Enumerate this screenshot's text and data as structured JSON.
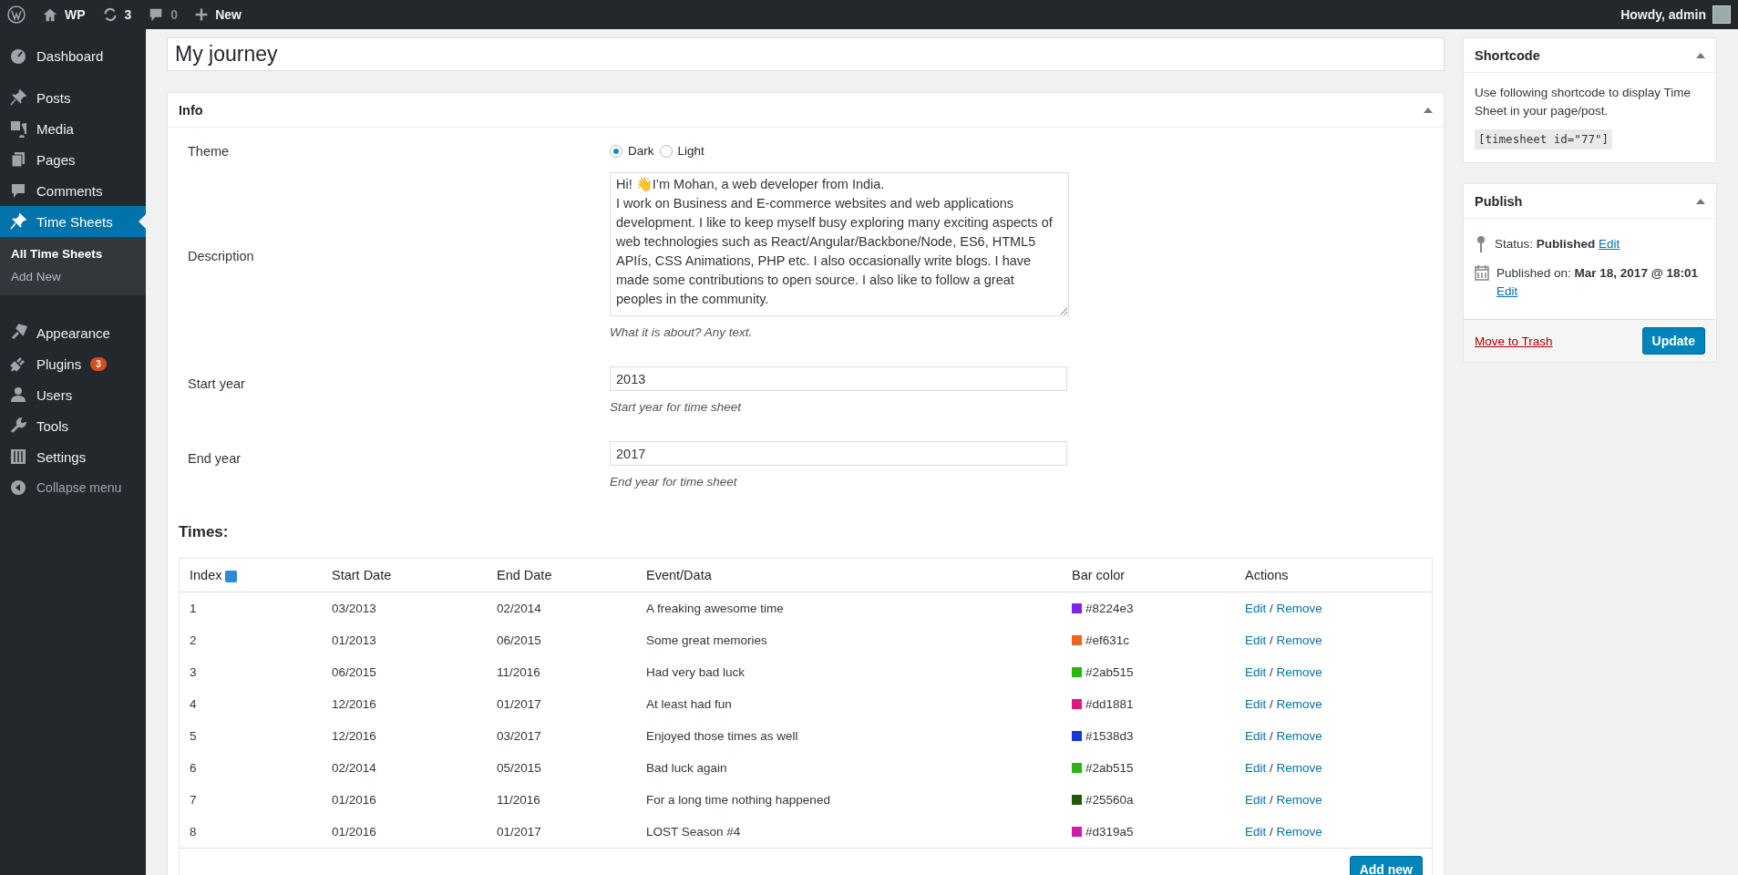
{
  "admin_bar": {
    "site": "WP",
    "updates": "3",
    "comments": "0",
    "new": "New",
    "greeting": "Howdy, admin"
  },
  "sidebar": {
    "items": [
      {
        "label": "Dashboard",
        "selected": false
      },
      {
        "label": "Posts",
        "selected": false
      },
      {
        "label": "Media",
        "selected": false
      },
      {
        "label": "Pages",
        "selected": false
      },
      {
        "label": "Comments",
        "selected": false
      },
      {
        "label": "Time Sheets",
        "selected": true,
        "children": [
          {
            "label": "All Time Sheets",
            "selected": true
          },
          {
            "label": "Add New",
            "selected": false
          }
        ]
      },
      {
        "label": "Appearance",
        "selected": false
      },
      {
        "label": "Plugins",
        "selected": false,
        "badge": "3"
      },
      {
        "label": "Users",
        "selected": false
      },
      {
        "label": "Tools",
        "selected": false
      },
      {
        "label": "Settings",
        "selected": false
      }
    ],
    "collapse": "Collapse menu"
  },
  "title": "My journey",
  "info": {
    "heading": "Info",
    "fields": [
      {
        "kind": "radio",
        "label": "Theme",
        "options": [
          {
            "label": "Dark",
            "selected": true
          },
          {
            "label": "Light",
            "selected": false
          }
        ]
      },
      {
        "kind": "textarea",
        "label": "Description",
        "value": "Hi! 👋I’m Mohan, a web developer from India.\nI work on Business and E-commerce websites and web applications development. I like to keep myself busy exploring many exciting aspects of web technologies such as React/Angular/Backbone/Node, ES6, HTML5 APIís, CSS Animations, PHP etc. I also occasionally write blogs. I have made some contributions to open source. I also like to follow a great peoples in the community.",
        "hint": "What it is about? Any text."
      },
      {
        "kind": "text",
        "label": "Start year",
        "value": "2013",
        "hint": "Start year for time sheet"
      },
      {
        "kind": "text",
        "label": "End year",
        "value": "2017",
        "hint": "End year for time sheet"
      }
    ]
  },
  "times": {
    "heading": "Times:",
    "columns": [
      "Index",
      "Start Date",
      "End Date",
      "Event/Data",
      "Bar color",
      "Actions"
    ],
    "rows": [
      {
        "index": "1",
        "start": "03/2013",
        "end": "02/2014",
        "event": "A freaking awesome time",
        "color": "#8224e3",
        "color_text": "#8224e3",
        "edit": "Edit",
        "separator": "/",
        "remove": "Remove"
      },
      {
        "index": "2",
        "start": "01/2013",
        "end": "06/2015",
        "event": "Some great memories",
        "color": "#ef631c",
        "color_text": "#ef631c",
        "edit": "Edit",
        "separator": "/",
        "remove": "Remove"
      },
      {
        "index": "3",
        "start": "06/2015",
        "end": "11/2016",
        "event": "Had very bad luck",
        "color": "#2ab515",
        "color_text": "#2ab515",
        "edit": "Edit",
        "separator": "/",
        "remove": "Remove"
      },
      {
        "index": "4",
        "start": "12/2016",
        "end": "01/2017",
        "event": "At least had fun",
        "color": "#dd1881",
        "color_text": "#dd1881",
        "edit": "Edit",
        "separator": "/",
        "remove": "Remove"
      },
      {
        "index": "5",
        "start": "12/2016",
        "end": "03/2017",
        "event": "Enjoyed those times as well",
        "color": "#1538d3",
        "color_text": "#1538d3",
        "edit": "Edit",
        "separator": "/",
        "remove": "Remove"
      },
      {
        "index": "6",
        "start": "02/2014",
        "end": "05/2015",
        "event": "Bad luck again",
        "color": "#2ab515",
        "color_text": "#2ab515",
        "edit": "Edit",
        "separator": "/",
        "remove": "Remove"
      },
      {
        "index": "7",
        "start": "01/2016",
        "end": "11/2016",
        "event": "For a long time nothing happened",
        "color": "#25560a",
        "color_text": "#25560a",
        "edit": "Edit",
        "separator": "/",
        "remove": "Remove"
      },
      {
        "index": "8",
        "start": "01/2016",
        "end": "01/2017",
        "event": "LOST Season #4",
        "color": "#d319a5",
        "color_text": "#d319a5",
        "edit": "Edit",
        "separator": "/",
        "remove": "Remove"
      }
    ],
    "add_button": "Add new"
  },
  "shortcode": {
    "heading": "Shortcode",
    "text": "Use following shortcode to display Time Sheet in your page/post.",
    "code": "[timesheet id=\"77\"]"
  },
  "publish": {
    "heading": "Publish",
    "status_label": "Status:",
    "status": "Published",
    "status_edit": "Edit",
    "date_label": "Published on:",
    "date": "Mar 18, 2017 @ 18:01",
    "date_edit": "Edit",
    "trash": "Move to Trash",
    "update": "Update"
  }
}
